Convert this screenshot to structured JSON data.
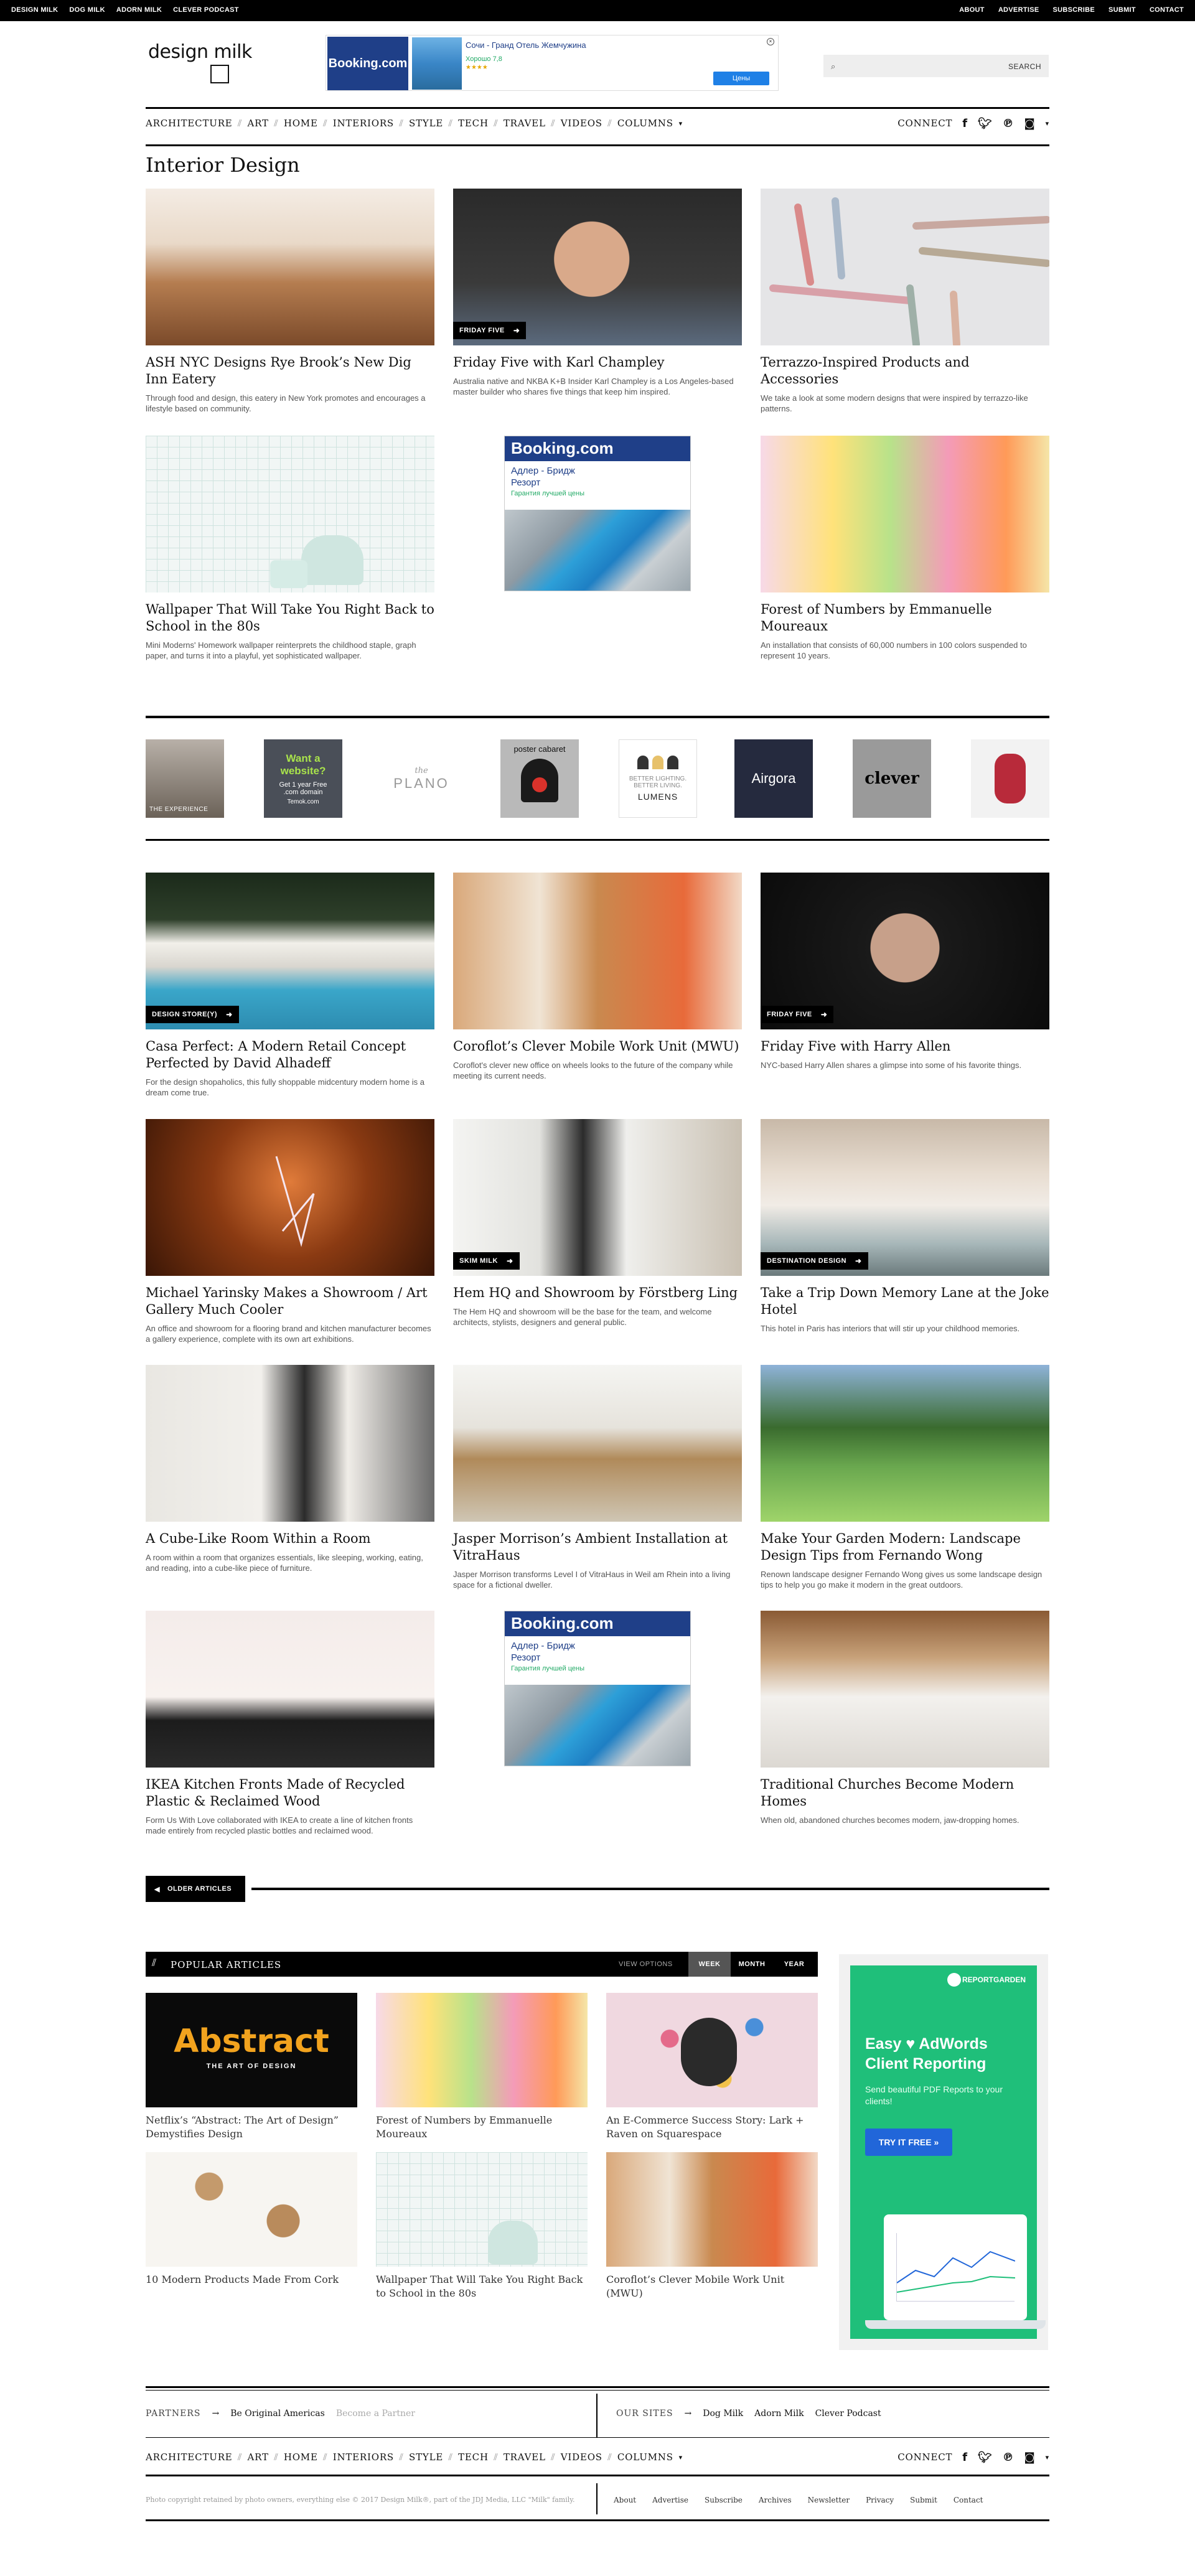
{
  "topbar": {
    "left": [
      "DESIGN MILK",
      "DOG MILK",
      "ADORN MILK",
      "CLEVER PODCAST"
    ],
    "right": [
      "ABOUT",
      "ADVERTISE",
      "SUBSCRIBE",
      "SUBMIT",
      "CONTACT"
    ]
  },
  "header": {
    "logo_text": "design milk",
    "search_label": "SEARCH",
    "ad": {
      "brand": "Booking.com",
      "title": "Сочи - Гранд Отель Жемчужина",
      "rating": "Хорошо 7,8",
      "stars": "★★★★",
      "cta": "Цены"
    }
  },
  "nav": {
    "items": [
      "ARCHITECTURE",
      "ART",
      "HOME",
      "INTERIORS",
      "STYLE",
      "TECH",
      "TRAVEL",
      "VIDEOS",
      "COLUMNS"
    ],
    "columns_caret": "▾",
    "connect": "CONNECT",
    "social": [
      "f",
      "t",
      "p",
      "ig"
    ],
    "more_caret": "▾"
  },
  "page_title": "Interior Design",
  "articles_top": [
    {
      "title": "ASH NYC Designs Rye Brook’s New Dig Inn Eatery",
      "desc": "Through food and design, this eatery in New York promotes and encourages a lifestyle based on community.",
      "tag": ""
    },
    {
      "title": "Friday Five with Karl Champley",
      "desc": "Australia native and NKBA K+B Insider Karl Champley is a Los Angeles-based master builder who shares five things that keep him inspired.",
      "tag": "FRIDAY FIVE"
    },
    {
      "title": "Terrazzo-Inspired Products and Accessories",
      "desc": "We take a look at some modern designs that were inspired by terrazzo-like patterns.",
      "tag": ""
    },
    {
      "title": "Wallpaper That Will Take You Right Back to School in the 80s",
      "desc": "Mini Moderns' Homework wallpaper reinterprets the childhood staple, graph paper, and turns it into a playful, yet sophisticated wallpaper.",
      "tag": ""
    },
    {
      "title": "Forest of Numbers by Emmanuelle Moureaux",
      "desc": "An installation that consists of 60,000 numbers in 100 colors suspended to represent 10 years.",
      "tag": ""
    }
  ],
  "inline_ad": {
    "brand": "Booking.com",
    "route_line1": "Адлер - Бридж",
    "route_line2": "Резорт",
    "note": "Гарантия лучшей цены"
  },
  "logo_strip": [
    {
      "text": "THE EXPERIENCE"
    },
    {
      "line1": "Want a",
      "line2": "website?",
      "line3": "Get 1 year Free",
      "line4": ".com domain",
      "line5": "Temok.com"
    },
    {
      "line1": "the",
      "line2": "PLANO"
    },
    {
      "text": "poster cabaret"
    },
    {
      "line1": "BETTER LIGHTING.",
      "line2": "BETTER LIVING.",
      "line3": "LUMENS"
    },
    {
      "text": "Airgora"
    },
    {
      "text": "clever"
    },
    {
      "text": ""
    }
  ],
  "articles_main": [
    {
      "title": "Casa Perfect: A Modern Retail Concept Perfected by David Alhadeff",
      "desc": "For the design shopaholics, this fully shoppable midcentury modern home is a dream come true.",
      "tag": "DESIGN STORE(Y)"
    },
    {
      "title": "Coroflot’s Clever Mobile Work Unit (MWU)",
      "desc": "Coroflot's clever new office on wheels looks to the future of the company while meeting its current needs.",
      "tag": ""
    },
    {
      "title": "Friday Five with Harry Allen",
      "desc": "NYC-based Harry Allen shares a glimpse into some of his favorite things.",
      "tag": "FRIDAY FIVE"
    },
    {
      "title": "Michael Yarinsky Makes a Showroom / Art Gallery Much Cooler",
      "desc": "An office and showroom for a flooring brand and kitchen manufacturer becomes a gallery experience, complete with its own art exhibitions.",
      "tag": ""
    },
    {
      "title": "Hem HQ and Showroom by Förstberg Ling",
      "desc": "The Hem HQ and showroom will be the base for the team, and welcome architects, stylists, designers and general public.",
      "tag": "SKIM MILK"
    },
    {
      "title": "Take a Trip Down Memory Lane at the Joke Hotel",
      "desc": "This hotel in Paris has interiors that will stir up your childhood memories.",
      "tag": "DESTINATION DESIGN"
    },
    {
      "title": "A Cube-Like Room Within a Room",
      "desc": "A room within a room that organizes essentials, like sleeping, working, eating, and reading, into a cube-like piece of furniture.",
      "tag": ""
    },
    {
      "title": "Jasper Morrison’s Ambient Installation at VitraHaus",
      "desc": "Jasper Morrison transforms Level I of VitraHaus in Weil am Rhein into a living space for a fictional dweller.",
      "tag": ""
    },
    {
      "title": "Make Your Garden Modern: Landscape Design Tips from Fernando Wong",
      "desc": "Renown landscape designer Fernando Wong gives us some landscape design tips to help you go make it modern in the great outdoors.",
      "tag": ""
    },
    {
      "title": "IKEA Kitchen Fronts Made of Recycled Plastic & Reclaimed Wood",
      "desc": "Form Us With Love collaborated with IKEA to create a line of kitchen fronts made entirely from recycled plastic bottles and reclaimed wood.",
      "tag": ""
    },
    {
      "title": "Traditional Churches Become Modern Homes",
      "desc": "When old, abandoned churches becomes modern, jaw-dropping homes.",
      "tag": ""
    }
  ],
  "older_label": "OLDER ARTICLES",
  "popular": {
    "heading": "POPULAR ARTICLES",
    "view_options": "VIEW OPTIONS",
    "options": [
      "WEEK",
      "MONTH",
      "YEAR"
    ],
    "items": [
      {
        "title": "Netflix’s “Abstract: The Art of Design” Demystifies Design",
        "img_text": "Abstract",
        "img_sub": "THE ART OF DESIGN"
      },
      {
        "title": "Forest of Numbers by Emmanuelle Moureaux"
      },
      {
        "title": "An E-Commerce Success Story: Lark + Raven on Squarespace"
      },
      {
        "title": "10 Modern Products Made From Cork"
      },
      {
        "title": "Wallpaper That Will Take You Right Back to School in the 80s"
      },
      {
        "title": "Coroflot’s Clever Mobile Work Unit (MWU)"
      }
    ]
  },
  "side_ad": {
    "brand": "REPORTGARDEN",
    "headline": "Easy ♥ AdWords Client Reporting",
    "sub": "Send beautiful PDF Reports to your clients!",
    "cta": "TRY IT FREE »"
  },
  "footer": {
    "partners_label": "PARTNERS",
    "arrow": "→",
    "partner": "Be Original Americas",
    "become": "Become a Partner",
    "oursites_label": "OUR SITES",
    "sites": [
      "Dog Milk",
      "Adorn Milk",
      "Clever Podcast"
    ],
    "copyright": "Photo copyright retained by photo owners, everything else © 2017 Design Milk®, part of the JDJ Media, LLC \"Milk\" family.",
    "links": [
      "About",
      "Advertise",
      "Subscribe",
      "Archives",
      "Newsletter",
      "Privacy",
      "Submit",
      "Contact"
    ]
  },
  "colors": {
    "black": "#000000",
    "booking_blue": "#1f3f88",
    "ad_green": "#1fbf7a",
    "ad_blue": "#2166d9"
  }
}
